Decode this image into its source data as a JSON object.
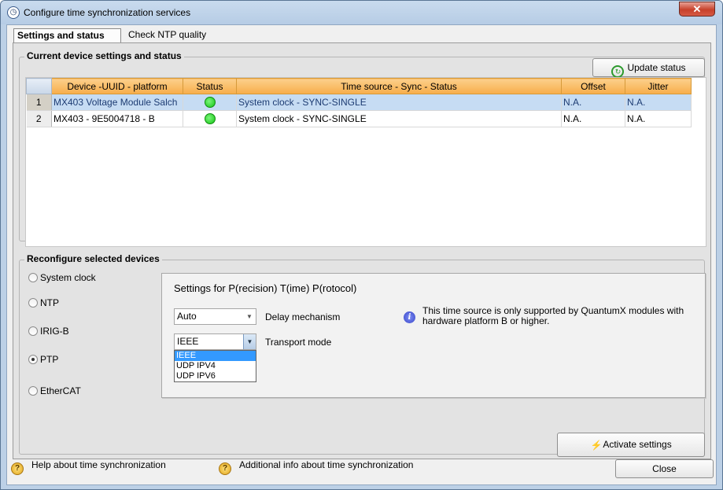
{
  "window": {
    "title": "Configure time synchronization services",
    "close_glyph": "✕"
  },
  "tabs": [
    {
      "label": "Settings and status"
    },
    {
      "label": "Check NTP quality"
    }
  ],
  "current_group": {
    "title": "Current device settings and status",
    "update_button": "Update status",
    "columns": [
      "Device  -UUID - platform",
      "Status",
      "Time source - Sync - Status",
      "Offset",
      "Jitter"
    ],
    "rows": [
      {
        "num": "1",
        "device": "MX403 Voltage Module Salch",
        "time_source": "System clock - SYNC-SINGLE",
        "offset": "N.A.",
        "jitter": "N.A.",
        "status_color": "#14c414"
      },
      {
        "num": "2",
        "device": "MX403 - 9E5004718 - B",
        "time_source": "System clock - SYNC-SINGLE",
        "offset": "N.A.",
        "jitter": "N.A.",
        "status_color": "#14c414"
      }
    ]
  },
  "reconfigure_group": {
    "title": "Reconfigure selected devices",
    "options": [
      {
        "label": "System clock",
        "checked": false
      },
      {
        "label": "NTP",
        "checked": false
      },
      {
        "label": "IRIG-B",
        "checked": false
      },
      {
        "label": "PTP",
        "checked": true
      },
      {
        "label": "EtherCAT",
        "checked": false
      }
    ],
    "ptp": {
      "title": "Settings for P(recision) T(ime) P(rotocol)",
      "delay_value": "Auto",
      "delay_label": "Delay mechanism",
      "transport_value": "IEEE",
      "transport_label": "Transport mode",
      "transport_options": [
        "IEEE",
        "UDP IPV4",
        "UDP IPV6"
      ],
      "info_text": "This time source is only supported by QuantumX modules with hardware platform B or higher."
    },
    "activate_button": "Activate settings"
  },
  "footer": {
    "help1": "Help about time synchronization",
    "help2": "Additional info about time synchronization",
    "close_button": "Close"
  },
  "icons": {
    "info": "info-icon",
    "help": "help-icon",
    "refresh": "refresh-icon",
    "activate": "activate-icon"
  }
}
